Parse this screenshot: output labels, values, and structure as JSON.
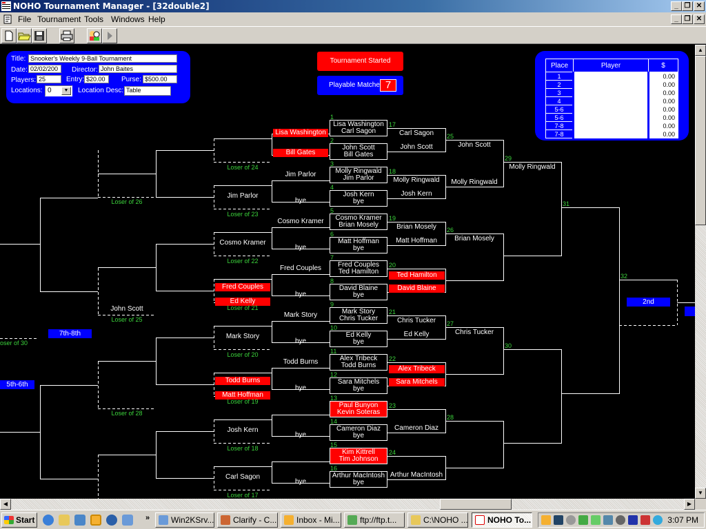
{
  "window": {
    "title": "NOHO Tournament Manager - [32double2]",
    "controls": [
      "_",
      "❐",
      "✕"
    ]
  },
  "menu": {
    "items": [
      "File",
      "Tournament",
      "Tools",
      "Windows",
      "Help"
    ]
  },
  "toolbar": {
    "buttons": [
      "new-file",
      "open-folder",
      "save",
      "print",
      "players",
      "play"
    ]
  },
  "info": {
    "title_label": "Title:",
    "title_value": "Snooker's Weekly 9-Ball Tournament",
    "date_label": "Date:",
    "date_value": "02/02/200",
    "director_label": "Director:",
    "director_value": "John Baites",
    "players_label": "Players:",
    "players_value": "25",
    "entry_label": "Entry:",
    "entry_value": "$20.00",
    "purse_label": "Purse:",
    "purse_value": "$500.00",
    "locations_label": "Locations:",
    "locations_value": "0",
    "location_desc_label": "Location Desc:",
    "location_desc_value": "Table"
  },
  "status": {
    "started": "Tournament Started",
    "playable_label": "Playable Matches:",
    "playable_count": "7"
  },
  "places": {
    "headers": [
      "Place",
      "Player",
      "$"
    ],
    "rows": [
      {
        "place": "1",
        "player": "",
        "amount": "0.00"
      },
      {
        "place": "2",
        "player": "",
        "amount": "0.00"
      },
      {
        "place": "3",
        "player": "",
        "amount": "0.00"
      },
      {
        "place": "4",
        "player": "",
        "amount": "0.00"
      },
      {
        "place": "5-6",
        "player": "",
        "amount": "0.00"
      },
      {
        "place": "5-6",
        "player": "",
        "amount": "0.00"
      },
      {
        "place": "7-8",
        "player": "",
        "amount": "0.00"
      },
      {
        "place": "7-8",
        "player": "",
        "amount": "0.00"
      }
    ]
  },
  "bracket": {
    "round1": [
      {
        "num": "1",
        "p1": "Lisa Washington",
        "p2": "Carl Sagon",
        "playable": false
      },
      {
        "num": "2",
        "p1": "John Scott",
        "p2": "Bill Gates",
        "playable": false
      },
      {
        "num": "3",
        "p1": "Molly Ringwald",
        "p2": "Jim Parlor",
        "playable": false
      },
      {
        "num": "4",
        "p1": "Josh Kern",
        "p2": "bye",
        "playable": false
      },
      {
        "num": "5",
        "p1": "Cosmo Kramer",
        "p2": "Brian Mosely",
        "playable": false
      },
      {
        "num": "6",
        "p1": "Matt Hoffman",
        "p2": "bye",
        "playable": false
      },
      {
        "num": "7",
        "p1": "Fred Couples",
        "p2": "Ted Hamilton",
        "playable": false
      },
      {
        "num": "8",
        "p1": "David Blaine",
        "p2": "bye",
        "playable": false
      },
      {
        "num": "9",
        "p1": "Mark Story",
        "p2": "Chris Tucker",
        "playable": false
      },
      {
        "num": "10",
        "p1": "Ed Kelly",
        "p2": "bye",
        "playable": false
      },
      {
        "num": "11",
        "p1": "Alex Tribeck",
        "p2": "Todd Burns",
        "playable": false
      },
      {
        "num": "12",
        "p1": "Sara Mitchels",
        "p2": "bye",
        "playable": false
      },
      {
        "num": "13",
        "p1": "Paul Bunyon",
        "p2": "Kevin Soteras",
        "playable": true
      },
      {
        "num": "14",
        "p1": "Cameron Diaz",
        "p2": "bye",
        "playable": false
      },
      {
        "num": "15",
        "p1": "Kim Kittrell",
        "p2": "Tim Johnson",
        "playable": true
      },
      {
        "num": "16",
        "p1": "Arthur MacIntosh",
        "p2": "bye",
        "playable": false
      }
    ],
    "round2": [
      {
        "num": "17",
        "p1": "Carl Sagon",
        "p2": "John Scott",
        "playable": false
      },
      {
        "num": "18",
        "p1": "Molly Ringwald",
        "p2": "Josh Kern",
        "playable": false
      },
      {
        "num": "19",
        "p1": "Brian Mosely",
        "p2": "Matt Hoffman",
        "playable": false
      },
      {
        "num": "20",
        "p1": "Ted Hamilton",
        "p2": "David Blaine",
        "playable": true
      },
      {
        "num": "21",
        "p1": "Chris Tucker",
        "p2": "Ed Kelly",
        "playable": false
      },
      {
        "num": "22",
        "p1": "Alex Tribeck",
        "p2": "Sara Mitchels",
        "playable": true
      },
      {
        "num": "23",
        "p1": "",
        "p2": "Cameron Diaz",
        "playable": false
      },
      {
        "num": "24",
        "p1": "",
        "p2": "Arthur MacIntosh",
        "playable": false
      }
    ],
    "round3": [
      {
        "num": "25",
        "p1": "John Scott",
        "p2": "Molly Ringwald"
      },
      {
        "num": "26",
        "p1": "Brian Mosely",
        "p2": ""
      },
      {
        "num": "27",
        "p1": "Chris Tucker",
        "p2": ""
      },
      {
        "num": "28",
        "p1": "",
        "p2": ""
      }
    ],
    "round4": [
      {
        "num": "29",
        "p1": "Molly Ringwald",
        "p2": ""
      },
      {
        "num": "30",
        "p1": "",
        "p2": ""
      }
    ],
    "round5": [
      {
        "num": "31"
      }
    ],
    "final": {
      "num": "32",
      "label": "2nd"
    },
    "losers_r1": [
      {
        "p1": "Lisa Washington",
        "p2": "Bill Gates",
        "playable": true
      },
      {
        "p1": "Jim Parlor",
        "p2": "bye",
        "playable": false
      },
      {
        "p1": "Cosmo Kramer",
        "p2": "bye",
        "playable": false
      },
      {
        "p1": "Fred Couples",
        "p2": "bye",
        "playable": false
      },
      {
        "p1": "Mark Story",
        "p2": "bye",
        "playable": false
      },
      {
        "p1": "Todd Burns",
        "p2": "bye",
        "playable": false
      },
      {
        "p1": "",
        "p2": "bye",
        "playable": false
      },
      {
        "p1": "",
        "p2": "bye",
        "playable": false
      }
    ],
    "losers_r2": [
      {
        "name": "",
        "loser_of": "Loser of 24"
      },
      {
        "name": "Jim Parlor",
        "loser_of": "Loser of 23"
      },
      {
        "name": "Cosmo Kramer",
        "loser_of": "Loser of 22"
      },
      {
        "name": "",
        "loser_of": "Loser of 21",
        "red1": "Fred Couples",
        "red2": "Ed Kelly"
      },
      {
        "name": "Mark Story",
        "loser_of": "Loser of 20"
      },
      {
        "name": "",
        "loser_of": "Loser of 19",
        "red1": "Todd Burns",
        "red2": "Matt Hoffman"
      },
      {
        "name": "Josh Kern",
        "loser_of": "Loser of 18"
      },
      {
        "name": "Carl Sagon",
        "loser_of": "Loser of 17"
      }
    ],
    "losers_r3": [
      {
        "name": "",
        "loser_of": "Loser of 26"
      },
      {
        "name": "John Scott",
        "loser_of": "Loser of 25"
      },
      {
        "name": "",
        "loser_of": "Loser of 28"
      }
    ],
    "losers_r4": [
      {
        "loser_of": "oser of 30"
      }
    ],
    "place_labels": {
      "seventh": "7th-8th",
      "fifth": "5th-6th"
    }
  },
  "taskbar": {
    "start": "Start",
    "overflow": "»",
    "tasks": [
      "Win2KSrv...",
      "Clarify - C...",
      "Inbox - Mi...",
      "ftp://ftp.t...",
      "C:\\NOHO ...",
      "NOHO To..."
    ],
    "clock": "3:07 PM"
  },
  "colors": {
    "accent_blue": "#0000ff",
    "accent_red": "#ff0000",
    "match_number_green": "#3cd43c"
  }
}
